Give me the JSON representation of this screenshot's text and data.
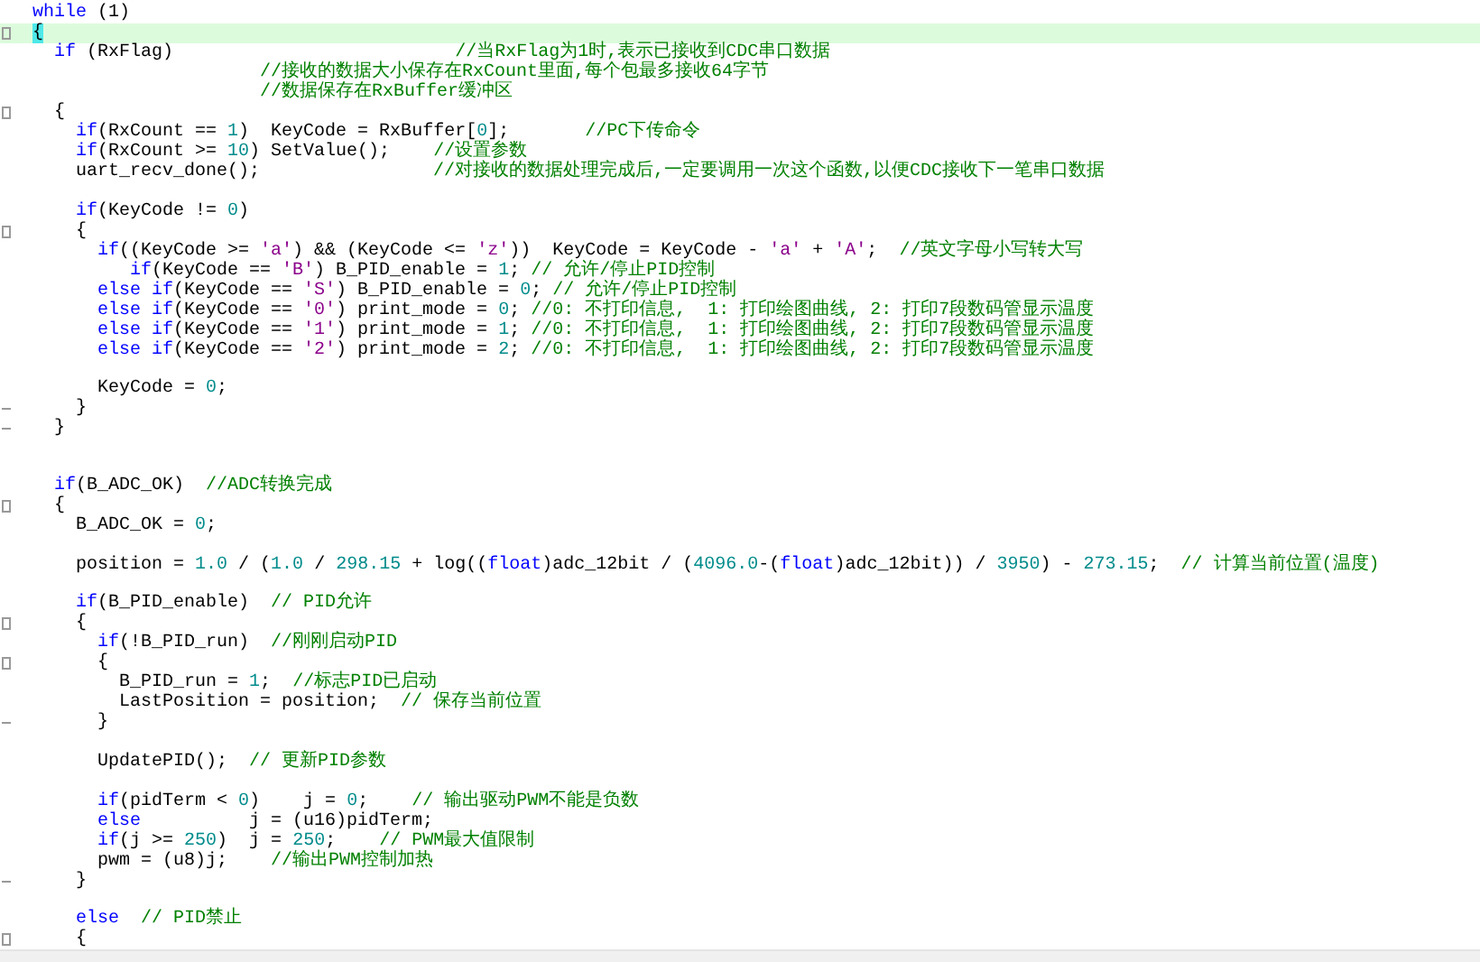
{
  "editor": {
    "lines": [
      {
        "kind": "code",
        "tokens": [
          {
            "kind": "keyword",
            "text": "while"
          },
          {
            "kind": "code",
            "text": " (1)"
          }
        ]
      },
      {
        "kind": "code",
        "current": true,
        "fold_start": true,
        "tokens": [
          {
            "kind": "brace",
            "text": "{"
          }
        ]
      },
      {
        "kind": "code",
        "tokens": [
          {
            "kind": "keyword",
            "text": "  if"
          },
          {
            "kind": "code",
            "text": " (RxFlag)                          "
          },
          {
            "kind": "comment",
            "text": "//当RxFlag为1时,表示已接收到CDC串口数据"
          }
        ]
      },
      {
        "kind": "code",
        "tokens": [
          {
            "kind": "comment",
            "text": "                     //接收的数据大小保存在RxCount里面,每个包最多接收64字节"
          }
        ]
      },
      {
        "kind": "code",
        "tokens": [
          {
            "kind": "comment",
            "text": "                     //数据保存在RxBuffer缓冲区"
          }
        ]
      },
      {
        "kind": "code",
        "fold_start": true,
        "tokens": [
          {
            "kind": "code",
            "text": "  {"
          }
        ]
      },
      {
        "kind": "code",
        "tokens": [
          {
            "kind": "keyword",
            "text": "    if"
          },
          {
            "kind": "code",
            "text": "(RxCount == "
          },
          {
            "kind": "number",
            "text": "1"
          },
          {
            "kind": "code",
            "text": ")  KeyCode = RxBuffer["
          },
          {
            "kind": "number",
            "text": "0"
          },
          {
            "kind": "code",
            "text": "];       "
          },
          {
            "kind": "comment",
            "text": "//PC下传命令"
          }
        ]
      },
      {
        "kind": "code",
        "tokens": [
          {
            "kind": "keyword",
            "text": "    if"
          },
          {
            "kind": "code",
            "text": "(RxCount >= "
          },
          {
            "kind": "number",
            "text": "10"
          },
          {
            "kind": "code",
            "text": ") SetValue();    "
          },
          {
            "kind": "comment",
            "text": "//设置参数"
          }
        ]
      },
      {
        "kind": "code",
        "tokens": [
          {
            "kind": "code",
            "text": "    uart_recv_done();                "
          },
          {
            "kind": "comment",
            "text": "//对接收的数据处理完成后,一定要调用一次这个函数,以便CDC接收下一笔串口数据"
          }
        ]
      },
      {
        "kind": "blank"
      },
      {
        "kind": "code",
        "tokens": [
          {
            "kind": "keyword",
            "text": "    if"
          },
          {
            "kind": "code",
            "text": "(KeyCode != "
          },
          {
            "kind": "number",
            "text": "0"
          },
          {
            "kind": "code",
            "text": ")"
          }
        ]
      },
      {
        "kind": "code",
        "fold_start": true,
        "tokens": [
          {
            "kind": "code",
            "text": "    {"
          }
        ]
      },
      {
        "kind": "code",
        "tokens": [
          {
            "kind": "keyword",
            "text": "      if"
          },
          {
            "kind": "code",
            "text": "((KeyCode >= "
          },
          {
            "kind": "char",
            "text": "'a'"
          },
          {
            "kind": "code",
            "text": ") && (KeyCode <= "
          },
          {
            "kind": "char",
            "text": "'z'"
          },
          {
            "kind": "code",
            "text": "))  KeyCode = KeyCode - "
          },
          {
            "kind": "char",
            "text": "'a'"
          },
          {
            "kind": "code",
            "text": " + "
          },
          {
            "kind": "char",
            "text": "'A'"
          },
          {
            "kind": "code",
            "text": ";  "
          },
          {
            "kind": "comment",
            "text": "//英文字母小写转大写"
          }
        ]
      },
      {
        "kind": "code",
        "tokens": [
          {
            "kind": "keyword",
            "text": "         if"
          },
          {
            "kind": "code",
            "text": "(KeyCode == "
          },
          {
            "kind": "char",
            "text": "'B'"
          },
          {
            "kind": "code",
            "text": ") B_PID_enable = "
          },
          {
            "kind": "number",
            "text": "1"
          },
          {
            "kind": "code",
            "text": "; "
          },
          {
            "kind": "comment",
            "text": "// 允许/停止PID控制"
          }
        ]
      },
      {
        "kind": "code",
        "tokens": [
          {
            "kind": "keyword",
            "text": "      else if"
          },
          {
            "kind": "code",
            "text": "(KeyCode == "
          },
          {
            "kind": "char",
            "text": "'S'"
          },
          {
            "kind": "code",
            "text": ") B_PID_enable = "
          },
          {
            "kind": "number",
            "text": "0"
          },
          {
            "kind": "code",
            "text": "; "
          },
          {
            "kind": "comment",
            "text": "// 允许/停止PID控制"
          }
        ]
      },
      {
        "kind": "code",
        "tokens": [
          {
            "kind": "keyword",
            "text": "      else if"
          },
          {
            "kind": "code",
            "text": "(KeyCode == "
          },
          {
            "kind": "char",
            "text": "'0'"
          },
          {
            "kind": "code",
            "text": ") print_mode = "
          },
          {
            "kind": "number",
            "text": "0"
          },
          {
            "kind": "code",
            "text": "; "
          },
          {
            "kind": "comment",
            "text": "//0: 不打印信息,  1: 打印绘图曲线, 2: 打印7段数码管显示温度"
          }
        ]
      },
      {
        "kind": "code",
        "tokens": [
          {
            "kind": "keyword",
            "text": "      else if"
          },
          {
            "kind": "code",
            "text": "(KeyCode == "
          },
          {
            "kind": "char",
            "text": "'1'"
          },
          {
            "kind": "code",
            "text": ") print_mode = "
          },
          {
            "kind": "number",
            "text": "1"
          },
          {
            "kind": "code",
            "text": "; "
          },
          {
            "kind": "comment",
            "text": "//0: 不打印信息,  1: 打印绘图曲线, 2: 打印7段数码管显示温度"
          }
        ]
      },
      {
        "kind": "code",
        "tokens": [
          {
            "kind": "keyword",
            "text": "      else if"
          },
          {
            "kind": "code",
            "text": "(KeyCode == "
          },
          {
            "kind": "char",
            "text": "'2'"
          },
          {
            "kind": "code",
            "text": ") print_mode = "
          },
          {
            "kind": "number",
            "text": "2"
          },
          {
            "kind": "code",
            "text": "; "
          },
          {
            "kind": "comment",
            "text": "//0: 不打印信息,  1: 打印绘图曲线, 2: 打印7段数码管显示温度"
          }
        ]
      },
      {
        "kind": "blank"
      },
      {
        "kind": "code",
        "tokens": [
          {
            "kind": "code",
            "text": "      KeyCode = "
          },
          {
            "kind": "number",
            "text": "0"
          },
          {
            "kind": "code",
            "text": ";"
          }
        ]
      },
      {
        "kind": "code",
        "fold_end": true,
        "tokens": [
          {
            "kind": "code",
            "text": "    }"
          }
        ]
      },
      {
        "kind": "code",
        "fold_end": true,
        "tokens": [
          {
            "kind": "code",
            "text": "  }"
          }
        ]
      },
      {
        "kind": "blank"
      },
      {
        "kind": "blank"
      },
      {
        "kind": "code",
        "tokens": [
          {
            "kind": "keyword",
            "text": "  if"
          },
          {
            "kind": "code",
            "text": "(B_ADC_OK)  "
          },
          {
            "kind": "comment",
            "text": "//ADC转换完成"
          }
        ]
      },
      {
        "kind": "code",
        "fold_start": true,
        "tokens": [
          {
            "kind": "code",
            "text": "  {"
          }
        ]
      },
      {
        "kind": "code",
        "tokens": [
          {
            "kind": "code",
            "text": "    B_ADC_OK = "
          },
          {
            "kind": "number",
            "text": "0"
          },
          {
            "kind": "code",
            "text": ";"
          }
        ]
      },
      {
        "kind": "blank"
      },
      {
        "kind": "code",
        "tokens": [
          {
            "kind": "code",
            "text": "    position = "
          },
          {
            "kind": "number",
            "text": "1.0"
          },
          {
            "kind": "code",
            "text": " / ("
          },
          {
            "kind": "number",
            "text": "1.0"
          },
          {
            "kind": "code",
            "text": " / "
          },
          {
            "kind": "number",
            "text": "298.15"
          },
          {
            "kind": "code",
            "text": " + log(("
          },
          {
            "kind": "keyword",
            "text": "float"
          },
          {
            "kind": "code",
            "text": ")adc_12bit / ("
          },
          {
            "kind": "number",
            "text": "4096.0"
          },
          {
            "kind": "code",
            "text": "-("
          },
          {
            "kind": "keyword",
            "text": "float"
          },
          {
            "kind": "code",
            "text": ")adc_12bit)) / "
          },
          {
            "kind": "number",
            "text": "3950"
          },
          {
            "kind": "code",
            "text": ") - "
          },
          {
            "kind": "number",
            "text": "273.15"
          },
          {
            "kind": "code",
            "text": ";  "
          },
          {
            "kind": "comment",
            "text": "// 计算当前位置(温度)"
          }
        ]
      },
      {
        "kind": "blank"
      },
      {
        "kind": "code",
        "tokens": [
          {
            "kind": "keyword",
            "text": "    if"
          },
          {
            "kind": "code",
            "text": "(B_PID_enable)  "
          },
          {
            "kind": "comment",
            "text": "// PID允许"
          }
        ]
      },
      {
        "kind": "code",
        "fold_start": true,
        "tokens": [
          {
            "kind": "code",
            "text": "    {"
          }
        ]
      },
      {
        "kind": "code",
        "tokens": [
          {
            "kind": "keyword",
            "text": "      if"
          },
          {
            "kind": "code",
            "text": "(!B_PID_run)  "
          },
          {
            "kind": "comment",
            "text": "//刚刚启动PID"
          }
        ]
      },
      {
        "kind": "code",
        "fold_start": true,
        "tokens": [
          {
            "kind": "code",
            "text": "      {"
          }
        ]
      },
      {
        "kind": "code",
        "tokens": [
          {
            "kind": "code",
            "text": "        B_PID_run = "
          },
          {
            "kind": "number",
            "text": "1"
          },
          {
            "kind": "code",
            "text": ";  "
          },
          {
            "kind": "comment",
            "text": "//标志PID已启动"
          }
        ]
      },
      {
        "kind": "code",
        "tokens": [
          {
            "kind": "code",
            "text": "        LastPosition = position;  "
          },
          {
            "kind": "comment",
            "text": "// 保存当前位置"
          }
        ]
      },
      {
        "kind": "code",
        "fold_end": true,
        "tokens": [
          {
            "kind": "code",
            "text": "      }"
          }
        ]
      },
      {
        "kind": "blank"
      },
      {
        "kind": "code",
        "tokens": [
          {
            "kind": "code",
            "text": "      UpdatePID();  "
          },
          {
            "kind": "comment",
            "text": "// 更新PID参数"
          }
        ]
      },
      {
        "kind": "blank"
      },
      {
        "kind": "code",
        "tokens": [
          {
            "kind": "keyword",
            "text": "      if"
          },
          {
            "kind": "code",
            "text": "(pidTerm < "
          },
          {
            "kind": "number",
            "text": "0"
          },
          {
            "kind": "code",
            "text": ")    j = "
          },
          {
            "kind": "number",
            "text": "0"
          },
          {
            "kind": "code",
            "text": ";    "
          },
          {
            "kind": "comment",
            "text": "// 输出驱动PWM不能是负数"
          }
        ]
      },
      {
        "kind": "code",
        "tokens": [
          {
            "kind": "keyword",
            "text": "      else"
          },
          {
            "kind": "code",
            "text": "          j = (u16)pidTerm;"
          }
        ]
      },
      {
        "kind": "code",
        "tokens": [
          {
            "kind": "keyword",
            "text": "      if"
          },
          {
            "kind": "code",
            "text": "(j >= "
          },
          {
            "kind": "number",
            "text": "250"
          },
          {
            "kind": "code",
            "text": ")  j = "
          },
          {
            "kind": "number",
            "text": "250"
          },
          {
            "kind": "code",
            "text": ";    "
          },
          {
            "kind": "comment",
            "text": "// PWM最大值限制"
          }
        ]
      },
      {
        "kind": "code",
        "tokens": [
          {
            "kind": "code",
            "text": "      pwm = (u8)j;    "
          },
          {
            "kind": "comment",
            "text": "//输出PWM控制加热"
          }
        ]
      },
      {
        "kind": "code",
        "fold_end": true,
        "tokens": [
          {
            "kind": "code",
            "text": "    }"
          }
        ]
      },
      {
        "kind": "blank"
      },
      {
        "kind": "code",
        "tokens": [
          {
            "kind": "keyword",
            "text": "    else"
          },
          {
            "kind": "comment",
            "text": "  // PID禁止"
          }
        ]
      },
      {
        "kind": "code",
        "fold_start": true,
        "tokens": [
          {
            "kind": "code",
            "text": "    {"
          }
        ]
      }
    ]
  }
}
